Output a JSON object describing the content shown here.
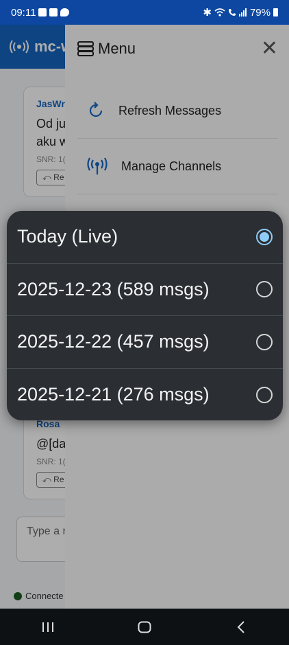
{
  "status": {
    "time": "09:11",
    "battery": "79%"
  },
  "app": {
    "title": "mc-w",
    "messages": [
      {
        "author": "JasWr",
        "text_lines": [
          "Od ju",
          "aku w"
        ],
        "meta": "SNR: 1(",
        "reply": "Re"
      },
      {
        "author": "Rosa",
        "text_lines": [
          "@[da"
        ],
        "meta": "SNR: 1(",
        "reply": "Re"
      }
    ],
    "compose_placeholder": "Type a r",
    "connection": "Connecte"
  },
  "drawer": {
    "title": "Menu",
    "items": [
      {
        "label": "Refresh Messages",
        "icon": "refresh-icon"
      },
      {
        "label": "Manage Channels",
        "icon": "antenna-icon"
      }
    ]
  },
  "picker": {
    "options": [
      {
        "label": "Today (Live)",
        "selected": true
      },
      {
        "label": "2025-12-23 (589 msgs)",
        "selected": false
      },
      {
        "label": "2025-12-22 (457 msgs)",
        "selected": false
      },
      {
        "label": "2025-12-21 (276 msgs)",
        "selected": false
      }
    ],
    "accent": "#8ecdf8"
  }
}
